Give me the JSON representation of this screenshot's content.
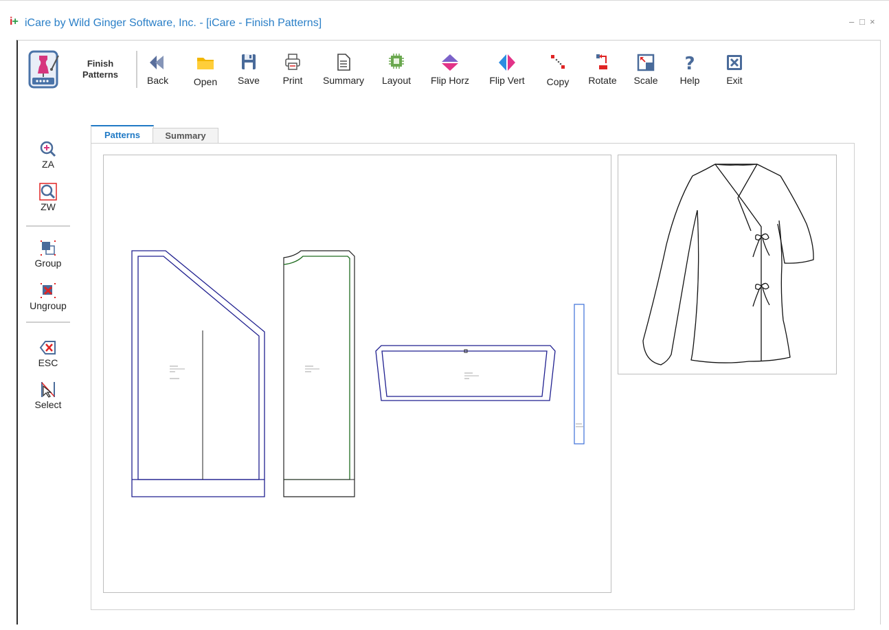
{
  "window": {
    "logo_text": "i+",
    "title": "iCare by Wild Ginger Software, Inc. - [iCare - Finish Patterns]",
    "controls": {
      "minimize": "–",
      "maximize": "□",
      "close": "×"
    }
  },
  "toolbar": {
    "mode_label": "Finish Patterns",
    "buttons": [
      {
        "id": "back",
        "label": "Back",
        "icon": "back-arrow-icon"
      },
      {
        "id": "open",
        "label": "Open",
        "icon": "folder-icon"
      },
      {
        "id": "save",
        "label": "Save",
        "icon": "floppy-disk-icon"
      },
      {
        "id": "print",
        "label": "Print",
        "icon": "printer-icon"
      },
      {
        "id": "summary",
        "label": "Summary",
        "icon": "document-icon"
      },
      {
        "id": "layout",
        "label": "Layout",
        "icon": "layout-chip-icon"
      },
      {
        "id": "flip_horz",
        "label": "Flip Horz",
        "icon": "flip-horizontal-icon"
      },
      {
        "id": "flip_vert",
        "label": "Flip Vert",
        "icon": "flip-vertical-icon"
      },
      {
        "id": "copy",
        "label": "Copy",
        "icon": "copy-dots-icon"
      },
      {
        "id": "rotate",
        "label": "Rotate",
        "icon": "rotate-icon"
      },
      {
        "id": "scale",
        "label": "Scale",
        "icon": "scale-icon"
      },
      {
        "id": "help",
        "label": "Help",
        "icon": "question-mark-icon"
      },
      {
        "id": "exit",
        "label": "Exit",
        "icon": "exit-x-icon"
      }
    ]
  },
  "side_tools": [
    {
      "id": "za",
      "label": "ZA",
      "icon": "zoom-all-icon"
    },
    {
      "id": "zw",
      "label": "ZW",
      "icon": "zoom-window-icon"
    },
    {
      "id": "group",
      "label": "Group",
      "icon": "group-icon"
    },
    {
      "id": "ungroup",
      "label": "Ungroup",
      "icon": "ungroup-icon"
    },
    {
      "id": "esc",
      "label": "ESC",
      "icon": "escape-icon"
    },
    {
      "id": "select",
      "label": "Select",
      "icon": "select-cursor-icon"
    }
  ],
  "tabs": [
    {
      "label": "Patterns",
      "active": true
    },
    {
      "label": "Summary",
      "active": false
    }
  ],
  "colors": {
    "title_blue": "#2a7fc7",
    "tab_active": "#1f79c5",
    "pattern_navy": "#1f1f8f",
    "pattern_green": "#1e6b1e",
    "pattern_light_blue": "#3b6fd8"
  }
}
